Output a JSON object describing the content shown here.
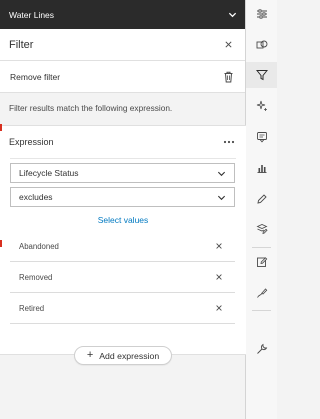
{
  "layer": {
    "title": "Water Lines"
  },
  "filter": {
    "title": "Filter",
    "remove_label": "Remove filter",
    "description": "Filter results match the following expression."
  },
  "expression": {
    "title": "Expression",
    "field_value": "Lifecycle Status",
    "operator_value": "excludes",
    "select_values_label": "Select values",
    "values": [
      "Abandoned",
      "Removed",
      "Retired"
    ]
  },
  "add_expression_label": "Add expression",
  "rail": {
    "icons": [
      "sliders-icon",
      "shapes-icon",
      "filter-icon",
      "sparkle-icon",
      "popup-icon",
      "chart-icon",
      "pencil-icon",
      "layers-edit-icon",
      "edit-icon",
      "draw-icon",
      "wrench-icon"
    ],
    "active": "filter-icon"
  },
  "colors": {
    "accent": "#0079c1",
    "title_bar": "#2b2b2b",
    "marker": "#d83020"
  }
}
